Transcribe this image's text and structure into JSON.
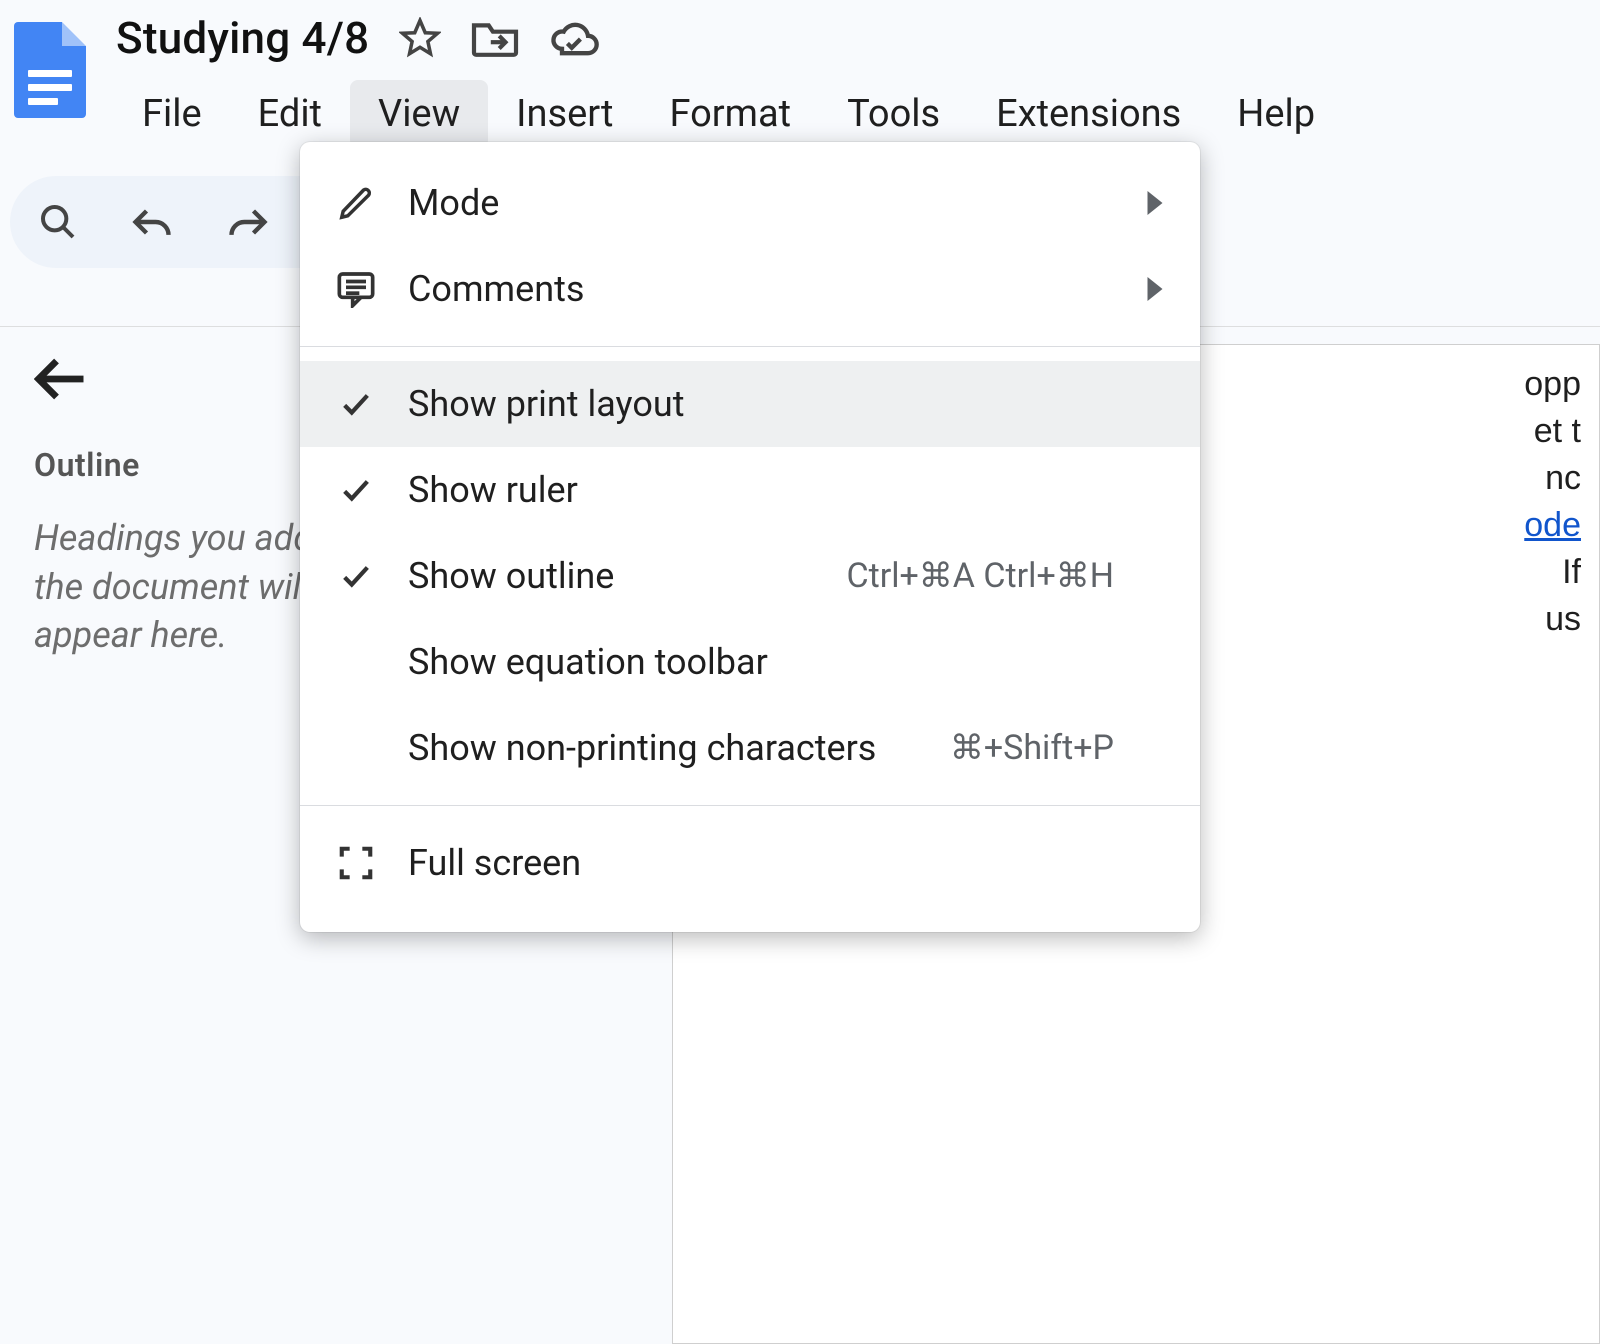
{
  "header": {
    "title": "Studying 4/8"
  },
  "menubar": {
    "items": [
      {
        "label": "File"
      },
      {
        "label": "Edit"
      },
      {
        "label": "View"
      },
      {
        "label": "Insert"
      },
      {
        "label": "Format"
      },
      {
        "label": "Tools"
      },
      {
        "label": "Extensions"
      },
      {
        "label": "Help"
      }
    ],
    "active_index": 2
  },
  "outline": {
    "heading": "Outline",
    "placeholder": "Headings you add to the document will appear here."
  },
  "view_menu": {
    "items": [
      {
        "icon": "pencil",
        "label": "Mode",
        "submenu": true,
        "checked": false,
        "shortcut": ""
      },
      {
        "icon": "comments",
        "label": "Comments",
        "submenu": true,
        "checked": false,
        "shortcut": ""
      },
      {
        "separator": true
      },
      {
        "icon": "check",
        "label": "Show print layout",
        "submenu": false,
        "checked": true,
        "shortcut": "",
        "hover": true
      },
      {
        "icon": "check",
        "label": "Show ruler",
        "submenu": false,
        "checked": true,
        "shortcut": ""
      },
      {
        "icon": "check",
        "label": "Show outline",
        "submenu": false,
        "checked": true,
        "shortcut": "Ctrl+⌘A Ctrl+⌘H"
      },
      {
        "icon": "",
        "label": "Show equation toolbar",
        "submenu": false,
        "checked": false,
        "shortcut": ""
      },
      {
        "icon": "",
        "label": "Show non-printing characters",
        "submenu": false,
        "checked": false,
        "shortcut": "⌘+Shift+P"
      },
      {
        "separator": true
      },
      {
        "icon": "fullscreen",
        "label": "Full screen",
        "submenu": false,
        "checked": false,
        "shortcut": ""
      }
    ]
  },
  "canvas": {
    "visible_lines": [
      "opp",
      "et t",
      "nc",
      "ode",
      " If",
      "us"
    ]
  }
}
